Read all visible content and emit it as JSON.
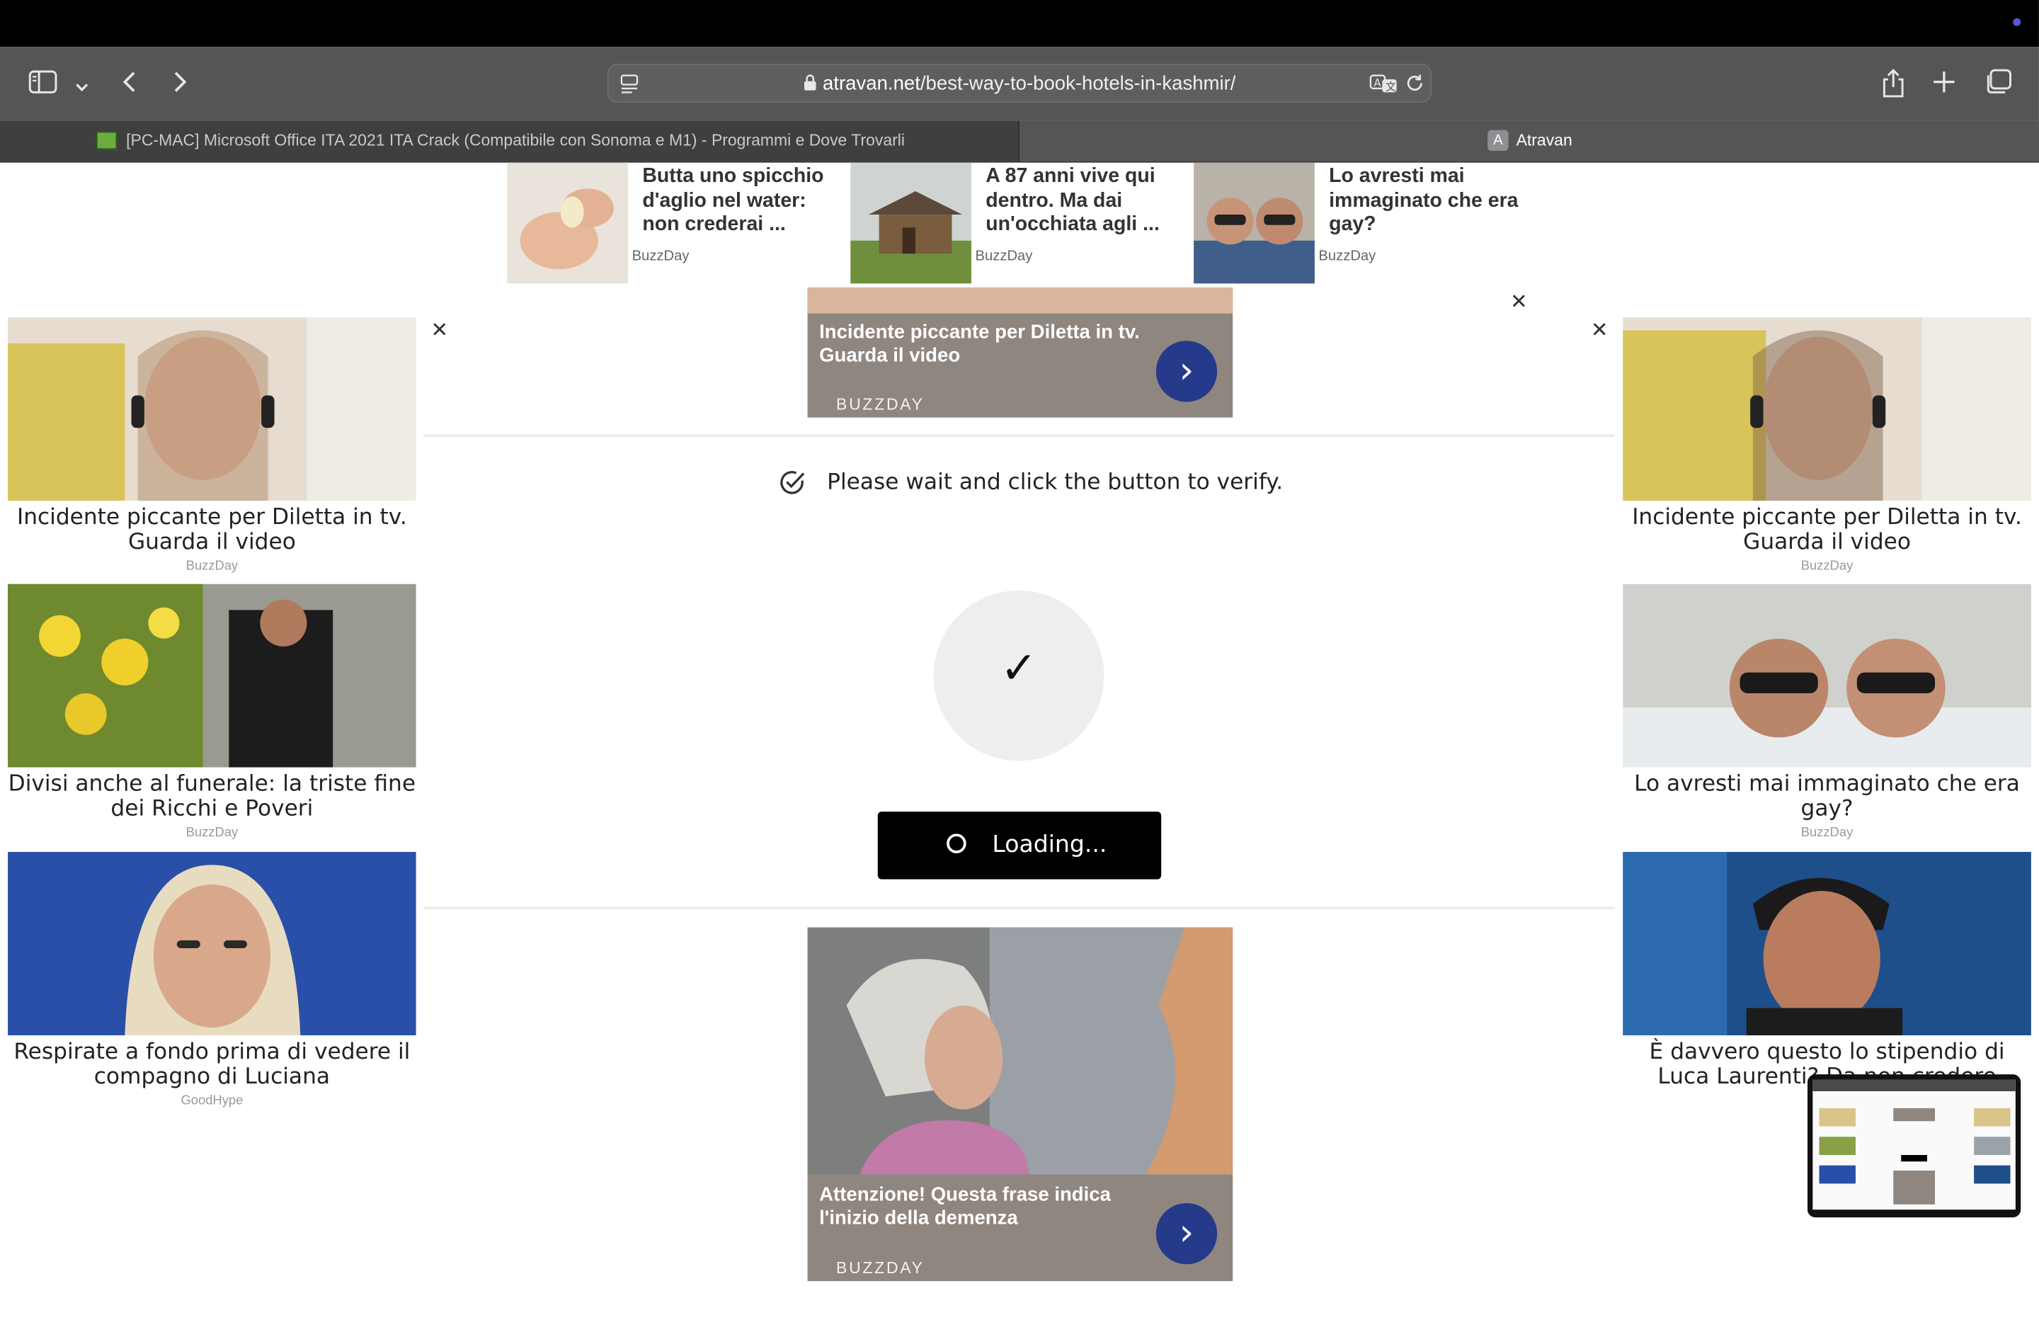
{
  "browser": {
    "address": {
      "host": "atravan.net",
      "path": "/best-way-to-book-hotels-in-kashmir/"
    },
    "tabs": [
      {
        "label": "[PC-MAC] Microsoft Office ITA 2021 ITA Crack (Compatibile con Sonoma e M1) - Programmi e Dove Trovarli",
        "active": false
      },
      {
        "label": "Atravan",
        "favicon_letter": "A",
        "active": true
      }
    ],
    "icons": [
      "sidebar-icon",
      "chevron-down-icon",
      "back-icon",
      "forward-icon",
      "reader-icon",
      "lock-icon",
      "translate-icon",
      "reload-icon",
      "share-icon",
      "new-tab-icon",
      "tab-overview-icon"
    ]
  },
  "top_ads": [
    {
      "title": "Butta uno spicchio d'aglio nel water: non crederai ...",
      "source": "BuzzDay"
    },
    {
      "title": "A 87 anni vive qui dentro. Ma dai un'occhiata agli ...",
      "source": "BuzzDay"
    },
    {
      "title": "Lo avresti mai immaginato che era gay?",
      "source": "BuzzDay"
    }
  ],
  "left_ads": [
    {
      "caption": "Incidente piccante per Diletta in tv. Guarda il video",
      "source": "BuzzDay"
    },
    {
      "caption": "Divisi anche al funerale: la triste fine dei Ricchi e Poveri",
      "source": "BuzzDay"
    },
    {
      "caption": "Respirate a fondo prima di vedere il compagno di Luciana",
      "source": "GoodHype"
    }
  ],
  "right_ads": [
    {
      "caption": "Incidente piccante per Diletta in tv. Guarda il video",
      "source": "BuzzDay"
    },
    {
      "caption": "Lo avresti mai immaginato che era gay?",
      "source": "BuzzDay"
    },
    {
      "caption": "È davvero questo lo stipendio di Luca Laurenti? Da non credere",
      "source": ""
    }
  ],
  "banners": {
    "top": {
      "title": "Incidente piccante per Diletta in tv. Guarda il video",
      "source": "BUZZDAY"
    },
    "bottom": {
      "title": "Attenzione! Questa frase indica l'inizio della demenza",
      "source": "BUZZDAY"
    }
  },
  "verify": {
    "message": "Please wait and click the button to verify.",
    "check_glyph": "✓",
    "button_label": "Loading..."
  },
  "close_glyph": "✕",
  "colors": {
    "banner_arrow": "#253a8a",
    "button_bg": "#000000",
    "toolbar_bg": "#555555"
  }
}
